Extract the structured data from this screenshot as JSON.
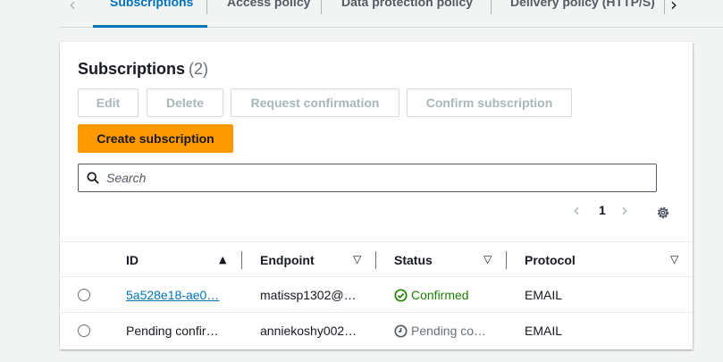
{
  "tabs": {
    "items": [
      "Subscriptions",
      "Access policy",
      "Data protection policy",
      "Delivery policy (HTTP/S)"
    ],
    "active": 0
  },
  "card": {
    "title": "Subscriptions",
    "count": "(2)"
  },
  "toolbar": {
    "edit_label": "Edit",
    "delete_label": "Delete",
    "request_confirmation_label": "Request confirmation",
    "confirm_subscription_label": "Confirm subscription",
    "create_subscription_label": "Create subscription"
  },
  "search": {
    "placeholder": "Search",
    "value": ""
  },
  "pagination": {
    "current_page": "1"
  },
  "table": {
    "columns": [
      "ID",
      "Endpoint",
      "Status",
      "Protocol"
    ],
    "rows": [
      {
        "id": "5a528e18-ae0…",
        "endpoint": "matissp1302@…",
        "status": "Confirmed",
        "protocol": "EMAIL"
      },
      {
        "id": "Pending confir…",
        "endpoint": "anniekoshy002…",
        "status": "Pending co…",
        "protocol": "EMAIL"
      }
    ]
  },
  "colors": {
    "accent": "#0073bb",
    "primary_button": "#ff9900",
    "confirmed": "#1d8102",
    "pending": "#687078"
  },
  "icons": {
    "tabs_prev": "chevron-left-icon",
    "tabs_next": "chevron-right-icon",
    "search": "search-icon",
    "settings": "gear-icon",
    "confirmed": "check-circle-icon",
    "pending": "clock-icon"
  }
}
